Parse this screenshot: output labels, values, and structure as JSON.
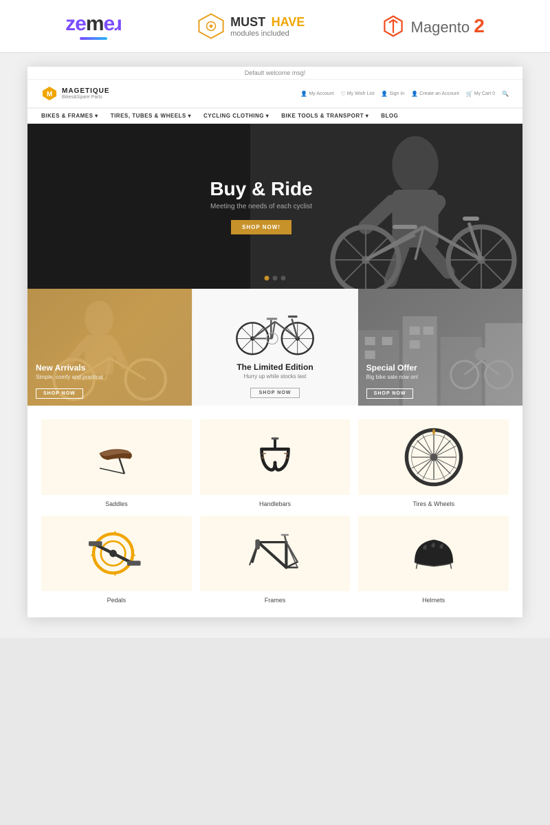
{
  "badge_bar": {
    "zemes": {
      "logo_text": "zemeɹ",
      "display": "ZEMES"
    },
    "must_have": {
      "line1_must": "MUST",
      "line1_have": "HAVE",
      "line2": "modules included"
    },
    "magento": {
      "text": "Magento",
      "version": "2"
    }
  },
  "site": {
    "welcome_msg": "Default welcome msg!",
    "logo_name": "MAGETIQUE",
    "logo_sub": "Bikes&Spare Parts",
    "nav_items": [
      {
        "label": "BIKES & FRAMES",
        "has_dropdown": true
      },
      {
        "label": "TIRES, TUBES & WHEELS",
        "has_dropdown": true
      },
      {
        "label": "CYCLING CLOTHING",
        "has_dropdown": true
      },
      {
        "label": "BIKE TOOLS & TRANSPORT",
        "has_dropdown": true
      },
      {
        "label": "BLOG",
        "has_dropdown": false
      }
    ],
    "header_icons": [
      {
        "label": "My Account",
        "icon": "person"
      },
      {
        "label": "My Wish List",
        "icon": "heart"
      },
      {
        "label": "Sign In",
        "icon": "person"
      },
      {
        "label": "Create an Account",
        "icon": "person"
      },
      {
        "label": "My Cart 0",
        "icon": "cart"
      },
      {
        "label": "Search",
        "icon": "search"
      }
    ],
    "hero": {
      "title": "Buy & Ride",
      "subtitle": "Meeting the needs of each cyclist",
      "cta_label": "SHOP NOW!"
    },
    "promo_panels": [
      {
        "id": "new-arrivals",
        "title": "New Arrivals",
        "subtitle": "Simple, comfy and practical",
        "cta": "SHOP NOW"
      },
      {
        "id": "limited-edition",
        "title": "The Limited Edition",
        "subtitle": "Hurry up while stocks last",
        "cta": "SHOP NOW"
      },
      {
        "id": "special-offer",
        "title": "Special Offer",
        "subtitle": "Big bike sale now on!",
        "cta": "SHOP NOW"
      }
    ],
    "categories": [
      {
        "name": "Saddles",
        "icon": "saddle"
      },
      {
        "name": "Handlebars",
        "icon": "handlebar"
      },
      {
        "name": "Tires & Wheels",
        "icon": "wheel"
      },
      {
        "name": "Pedals",
        "icon": "pedal"
      },
      {
        "name": "Frames",
        "icon": "frame"
      },
      {
        "name": "Helmets",
        "icon": "helmet"
      }
    ]
  }
}
